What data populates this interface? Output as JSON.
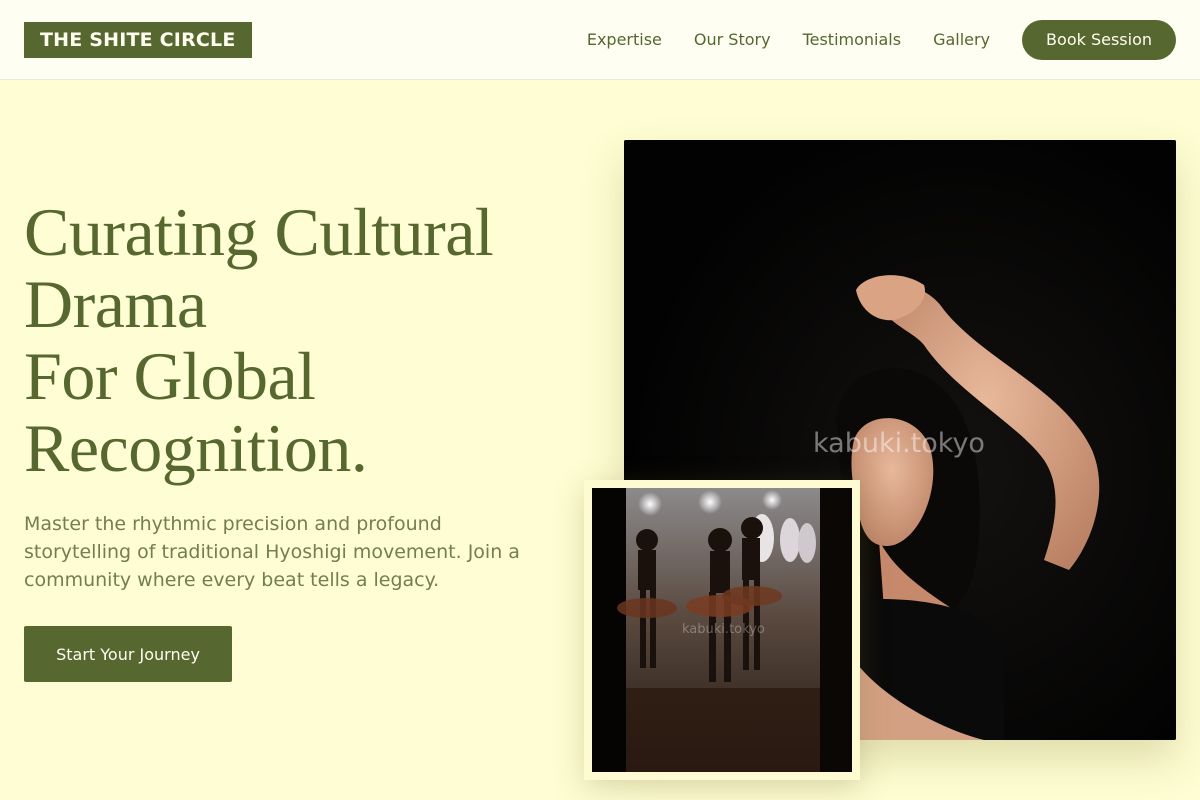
{
  "brand": {
    "logo": "THE SHITE CIRCLE"
  },
  "nav": {
    "links": [
      "Expertise",
      "Our Story",
      "Testimonials",
      "Gallery"
    ],
    "cta": "Book Session"
  },
  "hero": {
    "headline_lines": [
      "Curating Cultural",
      "Drama",
      "For Global",
      "Recognition."
    ],
    "subtext": "Master the rhythmic precision and profound storytelling of traditional Hyoshigi movement. Join a community where every beat tells a legacy.",
    "cta": "Start Your Journey"
  },
  "images": {
    "main_watermark": "kabuki.tokyo",
    "small_watermark": "kabuki.tokyo"
  },
  "colors": {
    "accent": "#56672f",
    "background": "#fefdd3",
    "header_bg": "#fefef2",
    "subtext": "#747e50"
  }
}
